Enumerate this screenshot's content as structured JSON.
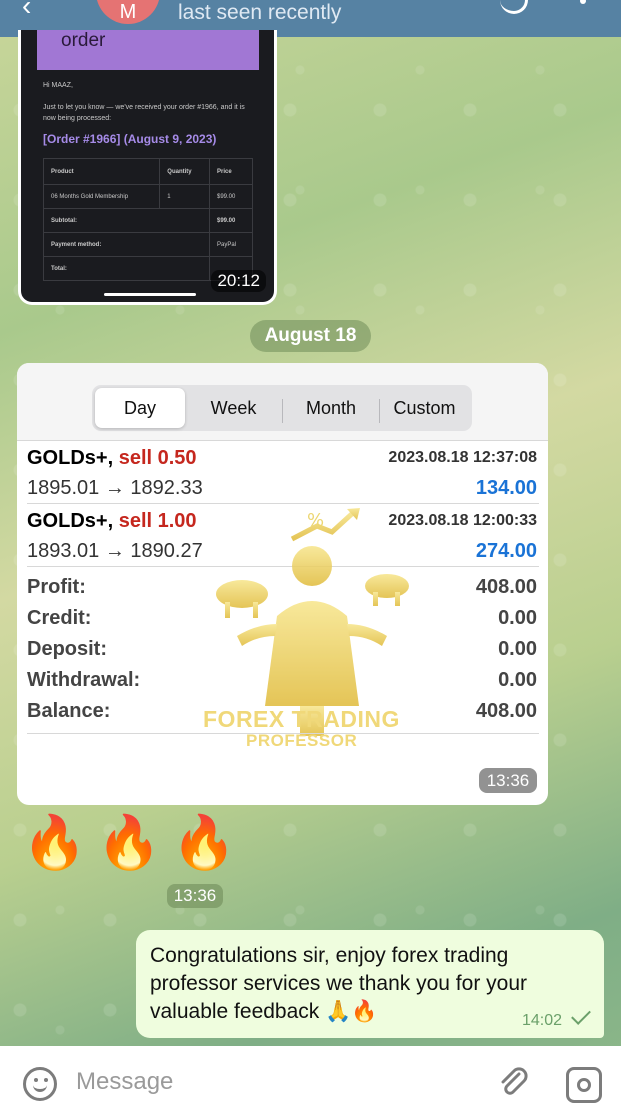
{
  "header": {
    "avatar_initial": "M",
    "status": "last seen recently"
  },
  "photo_message": {
    "banner_text": "order",
    "greeting": "Hi MAAZ,",
    "body_text": "Just to let you know — we've received your order #1966, and it is now being processed:",
    "order_title": "[Order #1966] (August 9, 2023)",
    "table": {
      "headers": [
        "Product",
        "Quantity",
        "Price"
      ],
      "rows": [
        [
          "06 Months Gold Membership",
          "1",
          "$99.00"
        ],
        [
          "Subtotal:",
          "",
          "$99.00"
        ],
        [
          "Payment method:",
          "",
          "PayPal"
        ],
        [
          "Total:",
          "",
          ""
        ]
      ]
    },
    "time": "20:12"
  },
  "date_separator": "August 18",
  "screenshot_card": {
    "tabs": [
      {
        "label": "Day",
        "active": true
      },
      {
        "label": "Week",
        "active": false
      },
      {
        "label": "Month",
        "active": false
      },
      {
        "label": "Custom",
        "active": false
      }
    ],
    "trades": [
      {
        "symbol": "GOLDs+,",
        "side": "sell 0.50",
        "datetime": "2023.08.18 12:37:08",
        "prices": "1895.01 → 1892.33",
        "profit": "134.00"
      },
      {
        "symbol": "GOLDs+,",
        "side": "sell 1.00",
        "datetime": "2023.08.18 12:00:33",
        "prices": "1893.01 → 1890.27",
        "profit": "274.00"
      }
    ],
    "summary": [
      {
        "label": "Profit:",
        "value": "408.00"
      },
      {
        "label": "Credit:",
        "value": "0.00"
      },
      {
        "label": "Deposit:",
        "value": "0.00"
      },
      {
        "label": "Withdrawal:",
        "value": "0.00"
      },
      {
        "label": "Balance:",
        "value": "408.00"
      }
    ],
    "watermark_line1": "FOREX TRADING",
    "watermark_line2": "PROFESSOR",
    "time": "13:36"
  },
  "emoji_message": {
    "emojis": "🔥🔥🔥",
    "time": "13:36"
  },
  "outgoing_message": {
    "text": "Congratulations sir, enjoy forex trading professor services we thank you for your valuable feedback 🙏🔥",
    "time": "14:02"
  },
  "input": {
    "placeholder": "Message"
  },
  "colors": {
    "header": "#5682a3",
    "sell": "#c5271e",
    "profit": "#1a73d6",
    "outgoing_bubble": "#effdde",
    "watermark": "#f0d879"
  }
}
